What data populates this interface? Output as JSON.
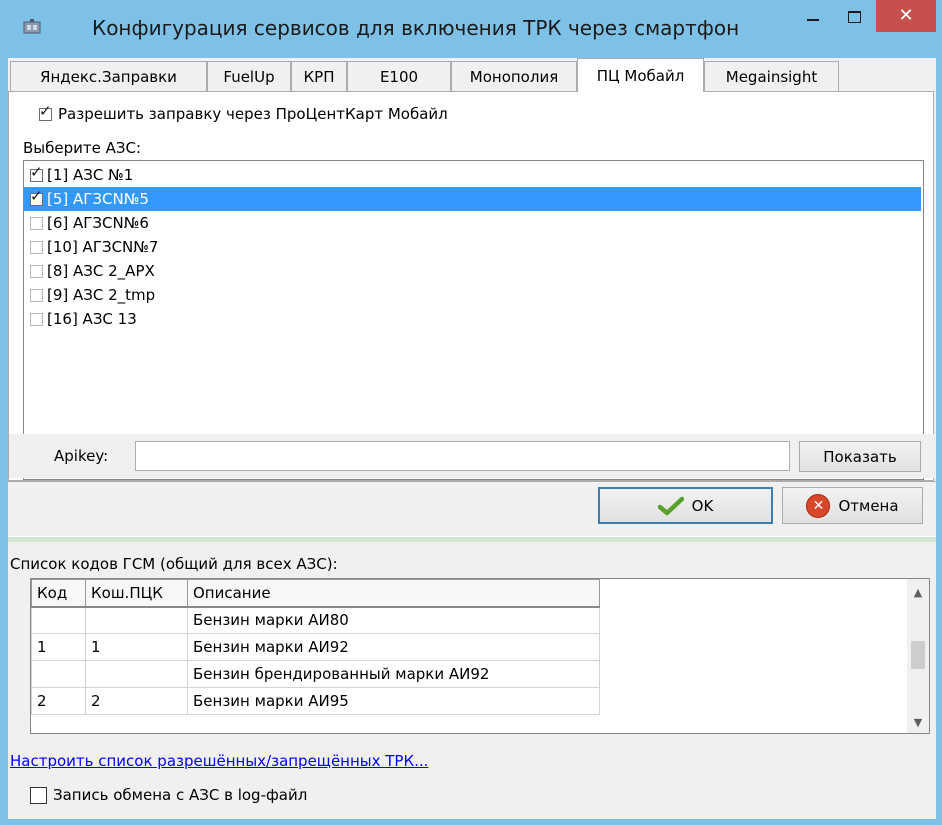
{
  "window": {
    "title": "Конфигурация сервисов для включения ТРК через смартфон",
    "close_glyph": "✕"
  },
  "tabs": [
    {
      "label": "Яндекс.Заправки",
      "active": false
    },
    {
      "label": "FuelUp",
      "active": false
    },
    {
      "label": "КРП",
      "active": false
    },
    {
      "label": "E100",
      "active": false
    },
    {
      "label": "Монополия",
      "active": false
    },
    {
      "label": "ПЦ Мобайл",
      "active": true
    },
    {
      "label": "Megainsight",
      "active": false
    }
  ],
  "panel": {
    "allow_label": "Разрешить заправку через ПроЦентКарт Мобайл",
    "allow_checked": true,
    "select_label": "Выберите АЗС:",
    "stations": [
      {
        "label": "[1] АЗС №1",
        "checked": true,
        "selected": false
      },
      {
        "label": "[5] АГЗСN№5",
        "checked": true,
        "selected": true
      },
      {
        "label": "[6] АГЗСN№6",
        "checked": false,
        "selected": false
      },
      {
        "label": "[10] АГЗСN№7",
        "checked": false,
        "selected": false
      },
      {
        "label": "[8] АЗС 2_APX",
        "checked": false,
        "selected": false
      },
      {
        "label": "[9] АЗС 2_tmp",
        "checked": false,
        "selected": false
      },
      {
        "label": "[16] АЗС 13",
        "checked": false,
        "selected": false
      }
    ],
    "apikey_label": "Apikey:",
    "apikey_value": "",
    "show_button": "Показать"
  },
  "buttons": {
    "ok": "OK",
    "cancel": "Отмена"
  },
  "codes": {
    "label": "Список кодов ГСМ (общий для всех АЗС):",
    "headers": [
      "Код",
      "Кош.ПЦК",
      "Описание"
    ],
    "rows": [
      [
        "",
        "",
        "Бензин марки АИ80"
      ],
      [
        "1",
        "1",
        "Бензин марки АИ92"
      ],
      [
        "",
        "",
        "Бензин брендированный марки АИ92"
      ],
      [
        "2",
        "2",
        "Бензин марки АИ95"
      ]
    ]
  },
  "link": "Настроить список разрешённых/запрещённых ТРК...",
  "log": {
    "label": "Запись обмена с АЗС в log-файл",
    "checked": false
  },
  "colors": {
    "accent": "#3399ff",
    "title_bar": "#7ec1e6",
    "close": "#c7504c",
    "link": "#0000ff"
  }
}
